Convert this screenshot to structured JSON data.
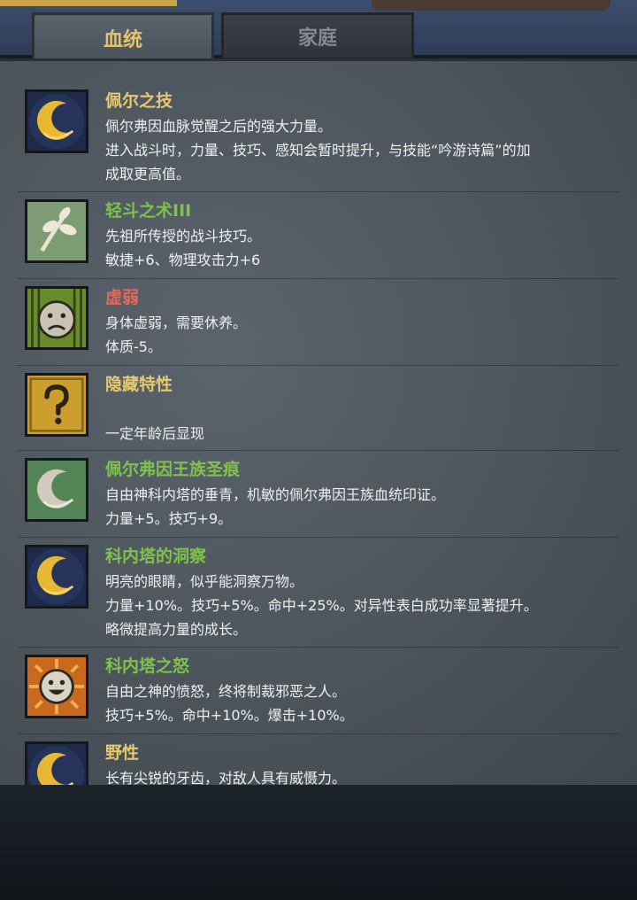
{
  "tabs": {
    "bloodline": "血统",
    "family": "家庭"
  },
  "traits": [
    {
      "name": "佩尔之技",
      "name_color": "gold",
      "icon": "crescent-moon-icon",
      "lines": [
        "佩尔弗因血脉觉醒之后的强大力量。",
        "进入战斗时，力量、技巧、感知会暂时提升，与技能“吟游诗篇”的加",
        "成取更高值。"
      ]
    },
    {
      "name": "轻斗之术III",
      "name_color": "green",
      "icon": "leaf-branch-icon",
      "lines": [
        "先祖所传授的战斗技巧。",
        "敏捷+6、物理攻击力+6"
      ]
    },
    {
      "name": "虚弱",
      "name_color": "red",
      "icon": "sad-face-icon",
      "lines": [
        "身体虚弱，需要休养。",
        "体质-5。"
      ]
    },
    {
      "name": "隐藏特性",
      "name_color": "gold",
      "icon": "question-mark-icon",
      "lines": [
        "",
        "一定年龄后显现"
      ]
    },
    {
      "name": "佩尔弗因王族圣痕",
      "name_color": "green",
      "icon": "silver-crescent-icon",
      "lines": [
        "自由神科内塔的垂青，机敏的佩尔弗因王族血统印证。",
        "力量+5。技巧+9。"
      ]
    },
    {
      "name": "科内塔的洞察",
      "name_color": "green",
      "icon": "crescent-moon-icon",
      "lines": [
        "明亮的眼睛，似乎能洞察万物。",
        "力量+10%。技巧+5%。命中+25%。对异性表白成功率显著提升。",
        "略微提高力量的成长。"
      ]
    },
    {
      "name": "科内塔之怒",
      "name_color": "green",
      "icon": "smiling-sun-icon",
      "lines": [
        "自由之神的愤怒，终将制裁邪恶之人。",
        "技巧+5%。命中+10%。爆击+10%。"
      ]
    },
    {
      "name": "野性",
      "name_color": "gold",
      "icon": "crescent-moon-icon",
      "lines": [
        "长有尖锐的牙齿，对敌人具有威慑力。"
      ]
    }
  ]
}
